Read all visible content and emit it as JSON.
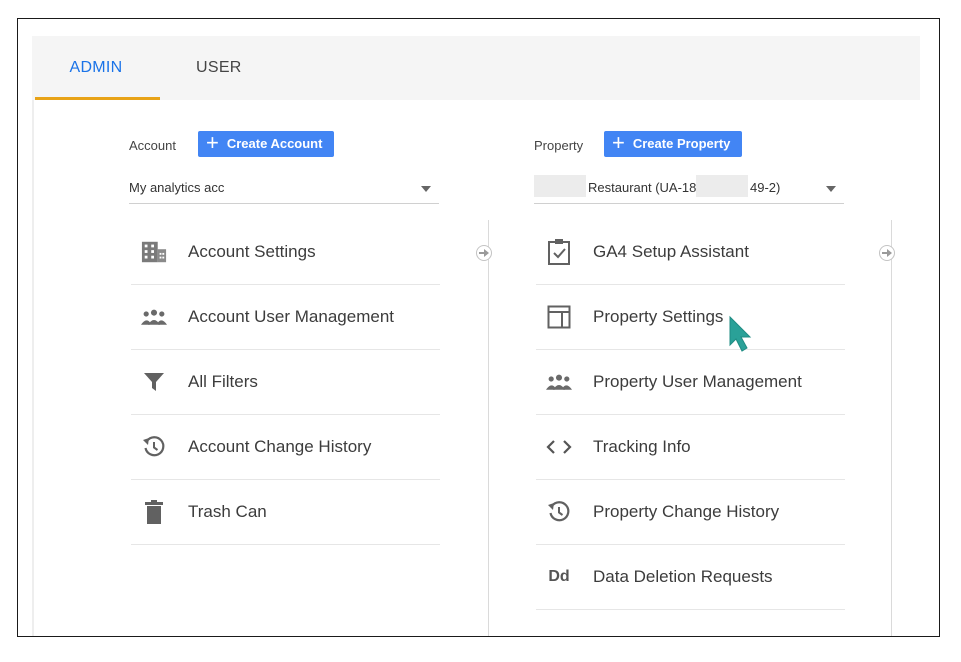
{
  "tabs": {
    "admin": "ADMIN",
    "user": "USER"
  },
  "account": {
    "label": "Account",
    "create_button": "Create Account",
    "selected": "My analytics acc",
    "items": [
      {
        "label": "Account Settings",
        "icon": "building-icon"
      },
      {
        "label": "Account User Management",
        "icon": "people-icon"
      },
      {
        "label": "All Filters",
        "icon": "filter-icon"
      },
      {
        "label": "Account Change History",
        "icon": "history-icon"
      },
      {
        "label": "Trash Can",
        "icon": "trash-icon"
      }
    ]
  },
  "property": {
    "label": "Property",
    "create_button": "Create Property",
    "selected_prefix": "Restaurant (UA-18",
    "selected_suffix": "49-2)",
    "items": [
      {
        "label": "GA4 Setup Assistant",
        "icon": "clipboard-check-icon"
      },
      {
        "label": "Property Settings",
        "icon": "layout-icon"
      },
      {
        "label": "Property User Management",
        "icon": "people-icon"
      },
      {
        "label": "Tracking Info",
        "icon": "code-icon"
      },
      {
        "label": "Property Change History",
        "icon": "history-icon"
      },
      {
        "label": "Data Deletion Requests",
        "icon": "dd-icon",
        "icon_text": "Dd"
      }
    ]
  },
  "colors": {
    "accent": "#1a73e8",
    "button": "#4285f4",
    "tab_underline": "#e8a317",
    "cursor": "#2aa198"
  }
}
